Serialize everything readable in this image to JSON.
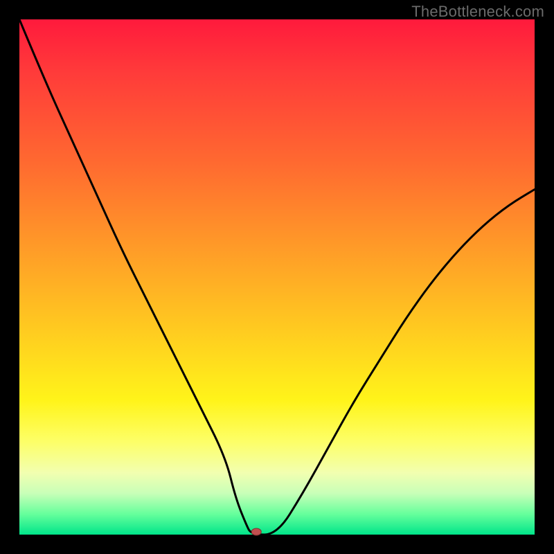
{
  "watermark": "TheBottleneck.com",
  "chart_data": {
    "type": "line",
    "title": "",
    "xlabel": "",
    "ylabel": "",
    "xlim": [
      0,
      100
    ],
    "ylim": [
      0,
      100
    ],
    "series": [
      {
        "name": "bottleneck-curve",
        "x": [
          0,
          5,
          10,
          15,
          20,
          25,
          30,
          35,
          40,
          42,
          44,
          45,
          50,
          55,
          60,
          65,
          70,
          75,
          80,
          85,
          90,
          95,
          100
        ],
        "values": [
          100,
          88,
          77,
          66,
          55,
          45,
          35,
          25,
          15,
          7,
          2,
          0,
          0,
          8,
          17,
          26,
          34,
          42,
          49,
          55,
          60,
          64,
          67
        ]
      }
    ],
    "marker": {
      "x": 46,
      "y": 0,
      "color": "#c05050"
    },
    "background_gradient": {
      "stops": [
        {
          "pos": 0,
          "color": "#ff1a3c"
        },
        {
          "pos": 10,
          "color": "#ff3a3a"
        },
        {
          "pos": 28,
          "color": "#ff6a30"
        },
        {
          "pos": 44,
          "color": "#ff9a28"
        },
        {
          "pos": 60,
          "color": "#ffca20"
        },
        {
          "pos": 74,
          "color": "#fff41a"
        },
        {
          "pos": 82,
          "color": "#fdff68"
        },
        {
          "pos": 88,
          "color": "#f2ffb0"
        },
        {
          "pos": 92,
          "color": "#c8ffb8"
        },
        {
          "pos": 96,
          "color": "#66ff9c"
        },
        {
          "pos": 100,
          "color": "#00e58a"
        }
      ]
    }
  }
}
